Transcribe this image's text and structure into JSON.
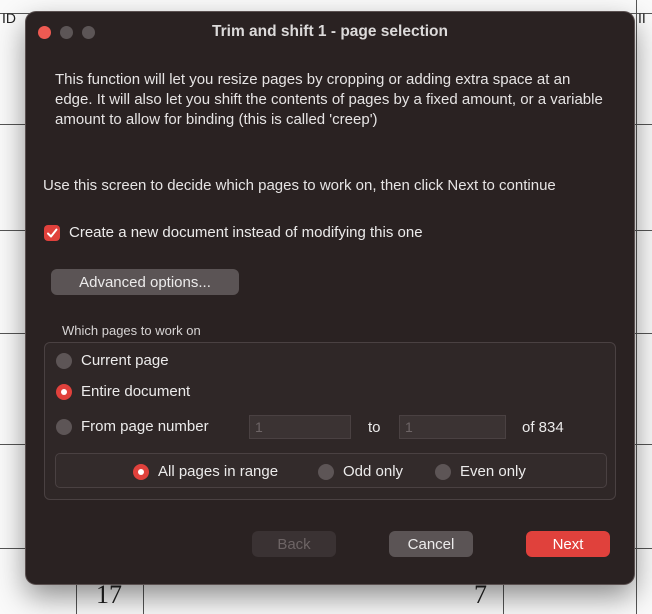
{
  "dialog": {
    "title": "Trim and shift 1 - page selection",
    "intro": "This function will let you resize pages by cropping or adding extra space at an edge. It will also let you shift the contents of pages by a fixed amount, or a variable amount to allow for binding (this is called 'creep')",
    "instructions": "Use this screen to decide which pages to work on, then click Next to continue",
    "new_document_checkbox": {
      "label": "Create a new document instead of modifying this one",
      "checked": true
    },
    "advanced_button": "Advanced options...",
    "pages_group": {
      "label": "Which pages to work on",
      "current_page": {
        "label": "Current page",
        "selected": false
      },
      "entire_document": {
        "label": "Entire document",
        "selected": true
      },
      "from_page": {
        "label": "From page number",
        "selected": false,
        "from_value": "1",
        "to_label": "to",
        "to_value": "1",
        "of_total": "of 834"
      },
      "subset": {
        "all_pages": {
          "label": "All pages in range",
          "selected": true
        },
        "odd_only": {
          "label": "Odd only",
          "selected": false
        },
        "even_only": {
          "label": "Even only",
          "selected": false
        }
      }
    },
    "buttons": {
      "back": "Back",
      "cancel": "Cancel",
      "next": "Next"
    }
  },
  "background": {
    "left_fragment": "ID",
    "right_fragment": "II",
    "mark_left": "17",
    "mark_right": "7"
  },
  "colors": {
    "accent": "#e0413c",
    "dialog_bg": "#2a2222",
    "close_light": "#ee5a52"
  }
}
